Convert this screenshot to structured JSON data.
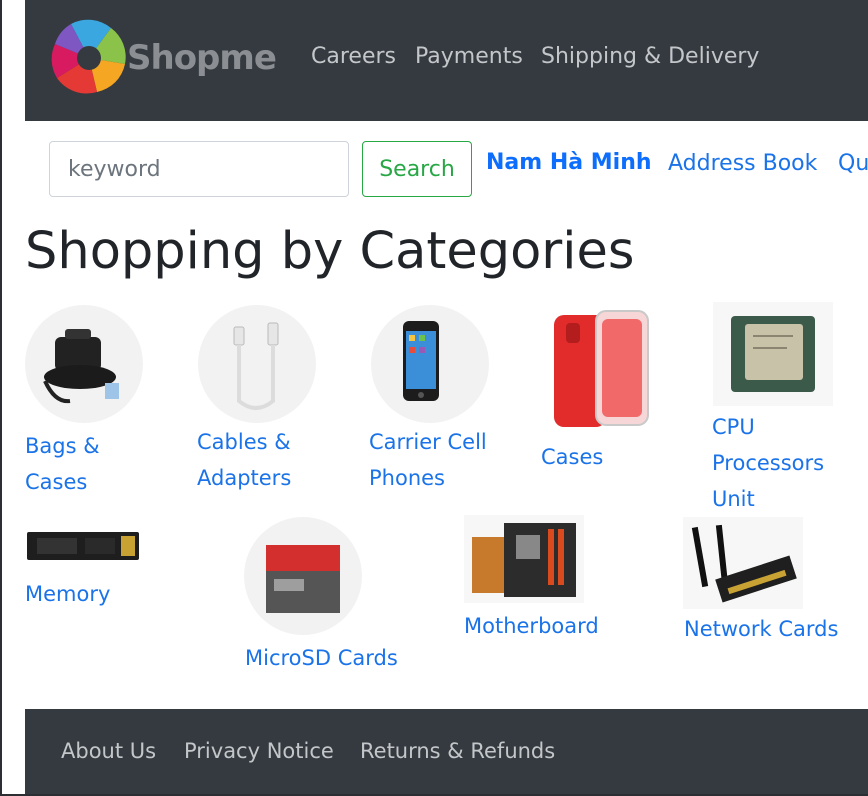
{
  "brand": {
    "name": "Shopme"
  },
  "header": {
    "nav_links": [
      "Careers",
      "Payments",
      "Shipping & Delivery"
    ]
  },
  "search": {
    "placeholder": "keyword",
    "button_label": "Search"
  },
  "account": {
    "user_name": "Nam Hà Minh",
    "address_book": "Address Book",
    "cut_link": "Qu"
  },
  "main": {
    "title": "Shopping by Categories",
    "categories": [
      {
        "label_lines": [
          "Bags &",
          "Cases"
        ],
        "icon": "bag-icon"
      },
      {
        "label_lines": [
          "Cables &",
          "Adapters"
        ],
        "icon": "cable-icon"
      },
      {
        "label_lines": [
          "Carrier Cell",
          "Phones"
        ],
        "icon": "phone-icon"
      },
      {
        "label_lines": [
          "Cases"
        ],
        "icon": "phone-case-icon"
      },
      {
        "label_lines": [
          "CPU",
          "Processors",
          "Unit"
        ],
        "icon": "cpu-icon"
      },
      {
        "label_lines": [
          "Memory"
        ],
        "icon": "ssd-icon"
      },
      {
        "label_lines": [
          "MicroSD Cards"
        ],
        "icon": "sd-card-icon"
      },
      {
        "label_lines": [
          "Motherboard"
        ],
        "icon": "motherboard-icon"
      },
      {
        "label_lines": [
          "Network Cards"
        ],
        "icon": "network-card-icon"
      }
    ]
  },
  "footer": {
    "links": [
      "About Us",
      "Privacy Notice",
      "Returns & Refunds"
    ]
  },
  "colors": {
    "navbar_bg": "#343a40",
    "link_blue": "#1a73e8",
    "success_green": "#28a745"
  }
}
